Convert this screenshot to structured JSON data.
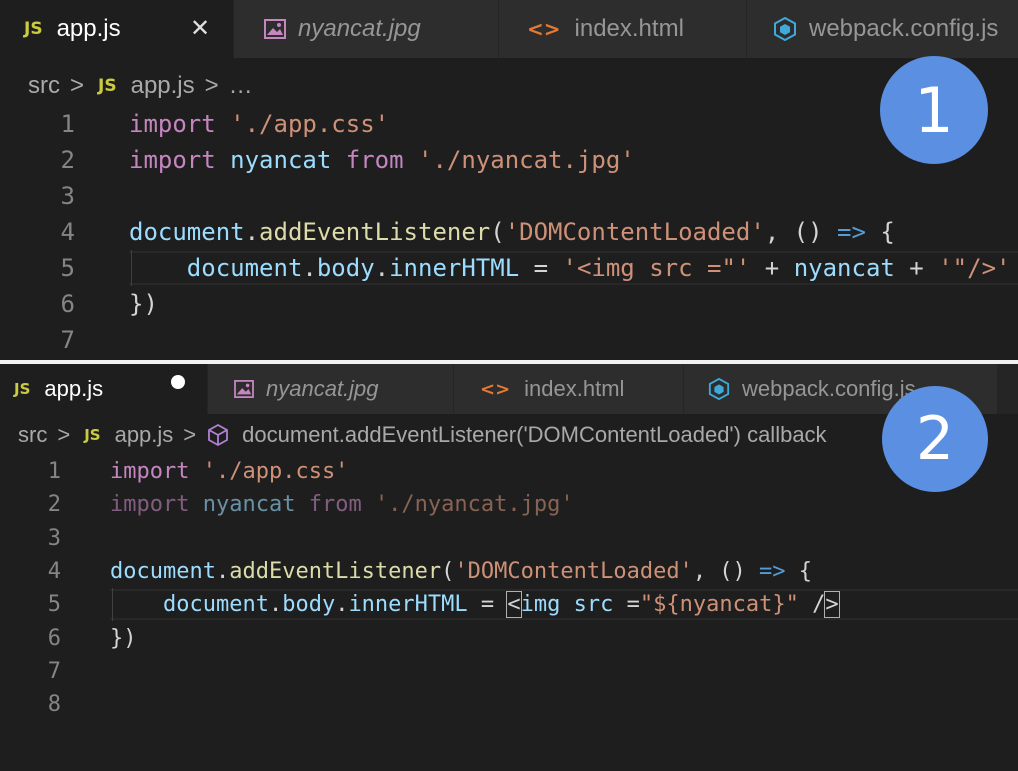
{
  "panel1": {
    "badge": "1",
    "tabs": [
      {
        "label": "app.js",
        "icon": "js-icon",
        "icon_text": "JS",
        "active": true,
        "close": "✕"
      },
      {
        "label": "nyancat.jpg",
        "icon": "image-icon"
      },
      {
        "label": "index.html",
        "icon": "html-brackets-icon",
        "icon_text": "<>"
      },
      {
        "label": "webpack.config.js",
        "icon": "webpack-cube-icon"
      }
    ],
    "breadcrumb": {
      "folder": "src",
      "file_icon": "JS",
      "file": "app.js",
      "more": "…"
    },
    "lines": [
      {
        "n": "1",
        "tokens": [
          [
            "kw",
            "import"
          ],
          [
            "op",
            " "
          ],
          [
            "str",
            "'./app.css'"
          ]
        ]
      },
      {
        "n": "2",
        "tokens": [
          [
            "kw",
            "import"
          ],
          [
            "op",
            " "
          ],
          [
            "var",
            "nyancat"
          ],
          [
            "op",
            " "
          ],
          [
            "kw",
            "from"
          ],
          [
            "op",
            " "
          ],
          [
            "str",
            "'./nyancat.jpg'"
          ]
        ]
      },
      {
        "n": "3",
        "tokens": []
      },
      {
        "n": "4",
        "tokens": [
          [
            "var",
            "document"
          ],
          [
            "op",
            "."
          ],
          [
            "fn",
            "addEventListener"
          ],
          [
            "op",
            "("
          ],
          [
            "str",
            "'DOMContentLoaded'"
          ],
          [
            "op",
            ", () "
          ],
          [
            "arrow",
            "=>"
          ],
          [
            "op",
            " {"
          ]
        ]
      },
      {
        "n": "5",
        "tokens": [
          [
            "op",
            "    "
          ],
          [
            "var",
            "document"
          ],
          [
            "op",
            "."
          ],
          [
            "var",
            "body"
          ],
          [
            "op",
            "."
          ],
          [
            "var",
            "innerHTML"
          ],
          [
            "op",
            " = "
          ],
          [
            "str",
            "'<img src =\"'"
          ],
          [
            "op",
            " + "
          ],
          [
            "var",
            "nyancat"
          ],
          [
            "op",
            " + "
          ],
          [
            "str",
            "'\"/>'"
          ]
        ]
      },
      {
        "n": "6",
        "tokens": [
          [
            "op",
            "})"
          ]
        ]
      },
      {
        "n": "7",
        "tokens": []
      }
    ]
  },
  "panel2": {
    "badge": "2",
    "tabs": [
      {
        "label": "app.js",
        "icon": "js-icon",
        "icon_text": "JS",
        "active": true,
        "dirty": true
      },
      {
        "label": "nyancat.jpg",
        "icon": "image-icon"
      },
      {
        "label": "index.html",
        "icon": "html-brackets-icon",
        "icon_text": "<>"
      },
      {
        "label": "webpack.config.js",
        "icon": "webpack-cube-icon"
      }
    ],
    "breadcrumb": {
      "folder": "src",
      "file_icon": "JS",
      "file": "app.js",
      "symbol": "document.addEventListener('DOMContentLoaded') callback"
    },
    "lines": [
      {
        "n": "1",
        "tokens": [
          [
            "kw",
            "import"
          ],
          [
            "op",
            " "
          ],
          [
            "str",
            "'./app.css'"
          ]
        ]
      },
      {
        "n": "2",
        "dim": true,
        "tokens": [
          [
            "kw",
            "import"
          ],
          [
            "op",
            " "
          ],
          [
            "var",
            "nyancat"
          ],
          [
            "op",
            " "
          ],
          [
            "kw",
            "from"
          ],
          [
            "op",
            " "
          ],
          [
            "str",
            "'./nyancat.jpg'"
          ]
        ]
      },
      {
        "n": "3",
        "tokens": []
      },
      {
        "n": "4",
        "tokens": [
          [
            "var",
            "document"
          ],
          [
            "op",
            "."
          ],
          [
            "fn",
            "addEventListener"
          ],
          [
            "op",
            "("
          ],
          [
            "str",
            "'DOMContentLoaded'"
          ],
          [
            "op",
            ", () "
          ],
          [
            "arrow",
            "=>"
          ],
          [
            "op",
            " {"
          ]
        ]
      },
      {
        "n": "5",
        "tokens": [
          [
            "op",
            "    "
          ],
          [
            "var",
            "document"
          ],
          [
            "op",
            "."
          ],
          [
            "var",
            "body"
          ],
          [
            "op",
            "."
          ],
          [
            "var",
            "innerHTML"
          ],
          [
            "op",
            " = "
          ],
          [
            "box",
            "<"
          ],
          [
            "var",
            "img"
          ],
          [
            "op",
            " "
          ],
          [
            "var",
            "src"
          ],
          [
            "op",
            " ="
          ],
          [
            "str",
            "\"${nyancat}\""
          ],
          [
            "op",
            " /"
          ],
          [
            "box",
            ">"
          ]
        ]
      },
      {
        "n": "6",
        "tokens": [
          [
            "op",
            "})"
          ]
        ]
      },
      {
        "n": "7",
        "tokens": []
      },
      {
        "n": "8",
        "tokens": []
      }
    ]
  },
  "colors": {
    "accent_badge": "#5b8fe2",
    "js_icon": "#cbcb41",
    "keyword": "#c586c0",
    "string": "#ce9178",
    "variable": "#9cdcfe",
    "function": "#dcdcaa"
  }
}
